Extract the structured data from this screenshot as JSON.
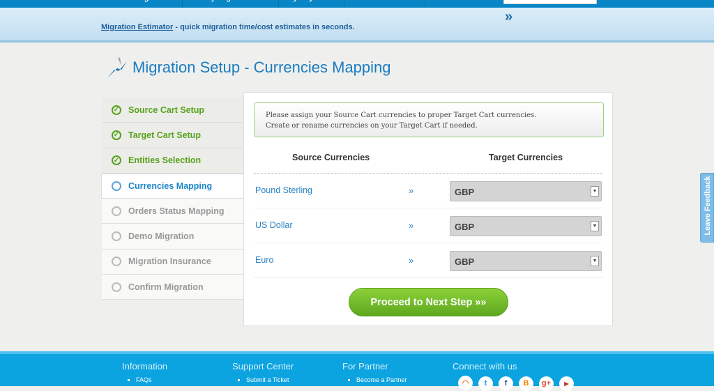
{
  "nav": {
    "items": [
      "Create Migration",
      "My Migrations",
      "My Payments",
      "Contact Us"
    ]
  },
  "banner": {
    "link": "Migration Estimator",
    "text": " - quick migration time/cost estimates in seconds.",
    "chevron": "»"
  },
  "page": {
    "title": "Migration Setup - Currencies Mapping"
  },
  "steps": [
    {
      "label": "Source Cart Setup",
      "state": "done"
    },
    {
      "label": "Target Cart Setup",
      "state": "done"
    },
    {
      "label": "Entities Selection",
      "state": "done"
    },
    {
      "label": "Currencies Mapping",
      "state": "current"
    },
    {
      "label": "Orders Status Mapping",
      "state": "todo"
    },
    {
      "label": "Demo Migration",
      "state": "todo"
    },
    {
      "label": "Migration Insurance",
      "state": "todo"
    },
    {
      "label": "Confirm Migration",
      "state": "todo"
    }
  ],
  "notice": {
    "line1": "Please assign your Source Cart currencies to proper Target Cart currencies.",
    "line2": "Create or rename currencies on your Target Cart if needed."
  },
  "table": {
    "source_header": "Source Currencies",
    "target_header": "Target Currencies",
    "arrow": "»",
    "rows": [
      {
        "source": "Pound Sterling",
        "target": "GBP"
      },
      {
        "source": "US Dollar",
        "target": "GBP"
      },
      {
        "source": "Euro",
        "target": "GBP"
      }
    ]
  },
  "proceed": "Proceed to Next Step »»",
  "feedback": "Leave Feedback",
  "footer": {
    "information": {
      "title": "Information",
      "link": "FAQs"
    },
    "support": {
      "title": "Support Center",
      "link": "Submit a Ticket"
    },
    "partner": {
      "title": "For Partner",
      "link": "Become a Partner"
    },
    "connect": {
      "title": "Connect with us",
      "icons": [
        "rss-icon",
        "twitter-icon",
        "facebook-icon",
        "blogger-icon",
        "google-plus-icon",
        "youtube-icon"
      ]
    }
  },
  "colors": {
    "accent": "#1a7cc1",
    "done": "#57a31c",
    "button": "#6fbb28",
    "footer": "#0ba3e0"
  }
}
